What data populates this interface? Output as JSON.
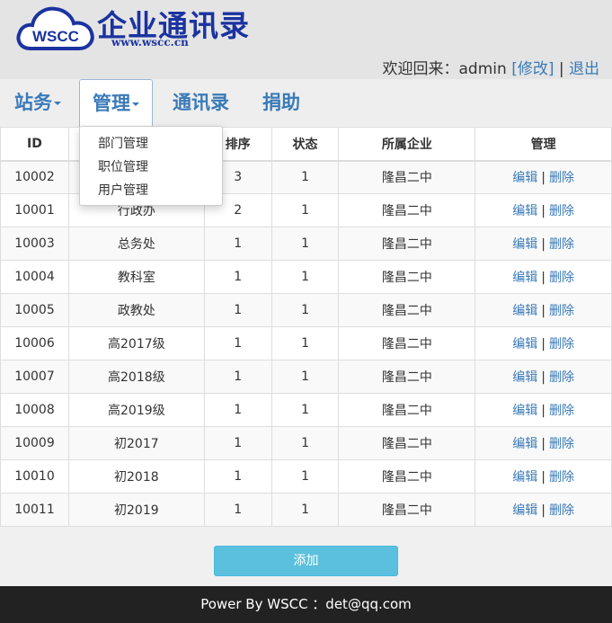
{
  "brand": {
    "logo_text": "WSCC",
    "title": "企业通讯录",
    "url": "www.wscc.cn",
    "color": "#1a33a0"
  },
  "welcome": {
    "prefix": "欢迎回来：admin",
    "edit_link": "[修改]",
    "separator": "|",
    "logout_link": "退出"
  },
  "nav": {
    "items": [
      {
        "label": "站务",
        "has_caret": true
      },
      {
        "label": "管理",
        "has_caret": true,
        "active": true
      },
      {
        "label": "通讯录"
      },
      {
        "label": "捐助"
      }
    ],
    "dropdown": [
      "部门管理",
      "职位管理",
      "用户管理"
    ]
  },
  "table": {
    "headers": [
      "ID",
      "",
      "排序",
      "状态",
      "所属企业",
      "管理"
    ],
    "rows": [
      {
        "id": "10002",
        "name": "",
        "order": "3",
        "status": "1",
        "company": "隆昌二中"
      },
      {
        "id": "10001",
        "name": "行政办",
        "order": "2",
        "status": "1",
        "company": "隆昌二中"
      },
      {
        "id": "10003",
        "name": "总务处",
        "order": "1",
        "status": "1",
        "company": "隆昌二中"
      },
      {
        "id": "10004",
        "name": "教科室",
        "order": "1",
        "status": "1",
        "company": "隆昌二中"
      },
      {
        "id": "10005",
        "name": "政教处",
        "order": "1",
        "status": "1",
        "company": "隆昌二中"
      },
      {
        "id": "10006",
        "name": "高2017级",
        "order": "1",
        "status": "1",
        "company": "隆昌二中"
      },
      {
        "id": "10007",
        "name": "高2018级",
        "order": "1",
        "status": "1",
        "company": "隆昌二中"
      },
      {
        "id": "10008",
        "name": "高2019级",
        "order": "1",
        "status": "1",
        "company": "隆昌二中"
      },
      {
        "id": "10009",
        "name": "初2017",
        "order": "1",
        "status": "1",
        "company": "隆昌二中"
      },
      {
        "id": "10010",
        "name": "初2018",
        "order": "1",
        "status": "1",
        "company": "隆昌二中"
      },
      {
        "id": "10011",
        "name": "初2019",
        "order": "1",
        "status": "1",
        "company": "隆昌二中"
      }
    ],
    "edit_label": "编辑",
    "delete_label": "删除",
    "action_separator": "|"
  },
  "add_button": "添加",
  "footer": "Power By WSCC ：det@qq.com",
  "colors": {
    "link": "#3a7ab8",
    "button": "#5bc0de",
    "footer_bg": "#222222"
  }
}
